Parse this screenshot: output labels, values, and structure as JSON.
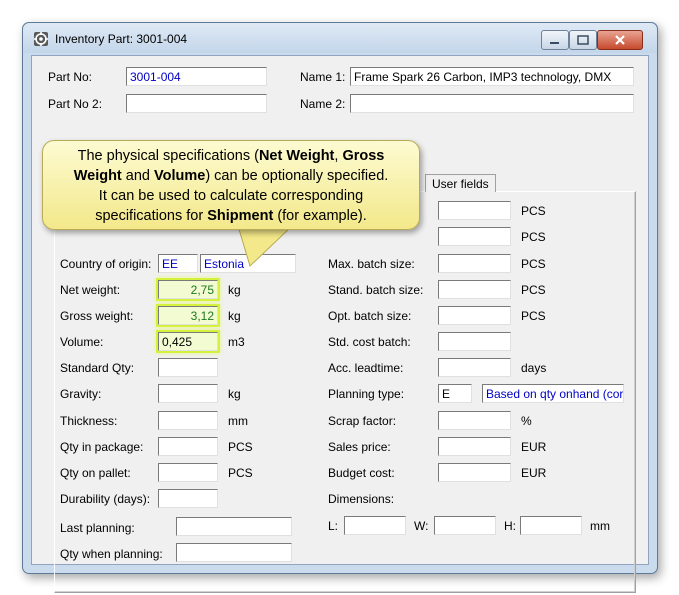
{
  "window": {
    "title": "Inventory Part: 3001-004",
    "buttons": [
      "minimize-button",
      "maximize-button",
      "close-button"
    ]
  },
  "header": {
    "part_no_label": "Part No:",
    "part_no": "3001-004",
    "name1_label": "Name 1:",
    "name1": "Frame Spark 26 Carbon, IMP3 technology, DMX",
    "part_no2_label": "Part No 2:",
    "part_no2": "",
    "name2_label": "Name 2:",
    "name2": ""
  },
  "tabs": {
    "user_fields": "User fields"
  },
  "left": {
    "country_label": "Country of origin:",
    "country_code": "EE",
    "country_name": "Estonia",
    "net_weight_label": "Net weight:",
    "net_weight": "2,75",
    "net_weight_unit": "kg",
    "gross_weight_label": "Gross weight:",
    "gross_weight": "3,12",
    "gross_weight_unit": "kg",
    "volume_label": "Volume:",
    "volume": "0,425",
    "volume_unit": "m3",
    "standard_qty_label": "Standard Qty:",
    "standard_qty": "",
    "gravity_label": "Gravity:",
    "gravity": "",
    "gravity_unit": "kg",
    "thickness_label": "Thickness:",
    "thickness": "",
    "thickness_unit": "mm",
    "qty_package_label": "Qty in package:",
    "qty_package": "",
    "qty_package_unit": "PCS",
    "qty_pallet_label": "Qty on pallet:",
    "qty_pallet": "",
    "qty_pallet_unit": "PCS",
    "durability_label": "Durability (days):",
    "durability": "",
    "last_planning_label": "Last planning:",
    "last_planning": "",
    "qty_when_planning_label": "Qty when planning:",
    "qty_when_planning": ""
  },
  "right": {
    "row1": "",
    "row1_unit": "PCS",
    "row2": "",
    "row2_unit": "PCS",
    "max_batch_label": "Max. batch size:",
    "max_batch": "",
    "max_batch_unit": "PCS",
    "stand_batch_label": "Stand. batch size:",
    "stand_batch": "",
    "stand_batch_unit": "PCS",
    "opt_batch_label": "Opt. batch size:",
    "opt_batch": "",
    "opt_batch_unit": "PCS",
    "std_cost_label": "Std. cost batch:",
    "std_cost": "",
    "acc_lead_label": "Acc. leadtime:",
    "acc_lead": "",
    "acc_lead_unit": "days",
    "planning_type_label": "Planning type:",
    "planning_type_code": "E",
    "planning_type_desc": "Based on qty onhand (cor",
    "scrap_label": "Scrap factor:",
    "scrap": "",
    "scrap_unit": "%",
    "sales_price_label": "Sales price:",
    "sales_price": "",
    "sales_price_unit": "EUR",
    "budget_cost_label": "Budget cost:",
    "budget_cost": "",
    "budget_cost_unit": "EUR",
    "dimensions_label": "Dimensions:",
    "l_label": "L:",
    "l": "",
    "w_label": "W:",
    "w": "",
    "h_label": "H:",
    "h": "",
    "dim_unit": "mm"
  },
  "callout": {
    "t1": "The physical specifications (",
    "b1": "Net Weight",
    "t2": ", ",
    "b2": "Gross",
    "b3": "Weight",
    "t3": " and ",
    "b4": "Volume",
    "t4": ") can be optionally specified.",
    "t5": "It can be used to calculate corresponding",
    "t6": "specifications for ",
    "b5": "Shipment",
    "t7": " (for example)."
  }
}
